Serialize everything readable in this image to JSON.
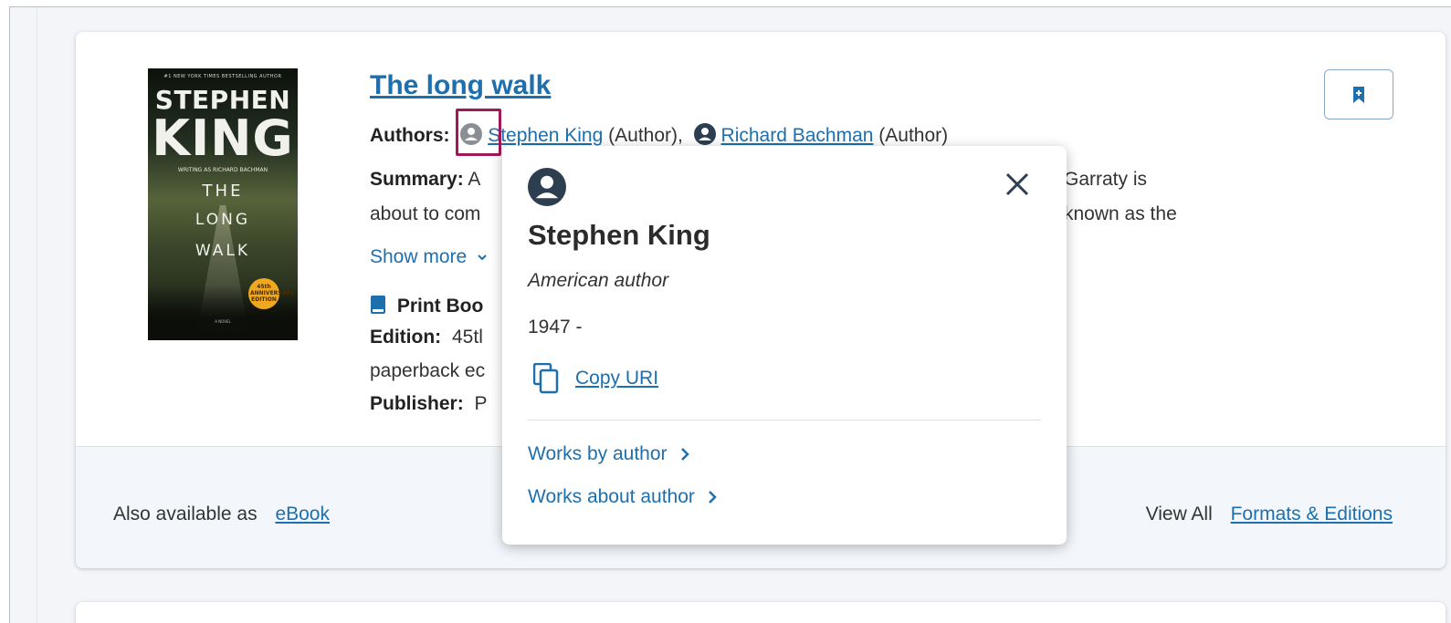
{
  "book": {
    "title": "The long walk",
    "cover": {
      "tagline": "#1 NEW YORK TIMES BESTSELLING AUTHOR",
      "author_first": "STEPHEN",
      "author_last": "KING",
      "writing_as": "WRITING AS RICHARD BACHMAN",
      "title_words": [
        "THE",
        "LONG",
        "WALK"
      ],
      "badge": "45th ANNIVERSARY EDITION",
      "novel": "A NOVEL"
    },
    "authors_label": "Authors:",
    "authors": [
      {
        "name": "Stephen King",
        "role": "(Author),"
      },
      {
        "name": "Richard Bachman",
        "role": "(Author)"
      }
    ],
    "summary_label": "Summary:",
    "summary_start": "A",
    "summary_line2_start": "about to com",
    "summary_right_line1": "Garraty is",
    "summary_right_line2": "known as the",
    "show_more": "Show more",
    "format_label": "Print Boo",
    "edition_label": "Edition:",
    "edition_value": "45tl",
    "edition_line2": "paperback ec",
    "publisher_label": "Publisher:",
    "publisher_value": "P"
  },
  "footer": {
    "also_available": "Also available as",
    "ebook_link": "eBook",
    "view_all": "View All",
    "formats_link": "Formats & Editions"
  },
  "popover": {
    "name": "Stephen King",
    "description": "American author",
    "years": "1947 -",
    "copy_uri": "Copy URI",
    "works_by": "Works by author",
    "works_about": "Works about author"
  },
  "colors": {
    "link": "#1d6fae",
    "highlight": "#a0195a",
    "icon_dark": "#2c3e50",
    "icon_muted": "#8a8f96"
  }
}
